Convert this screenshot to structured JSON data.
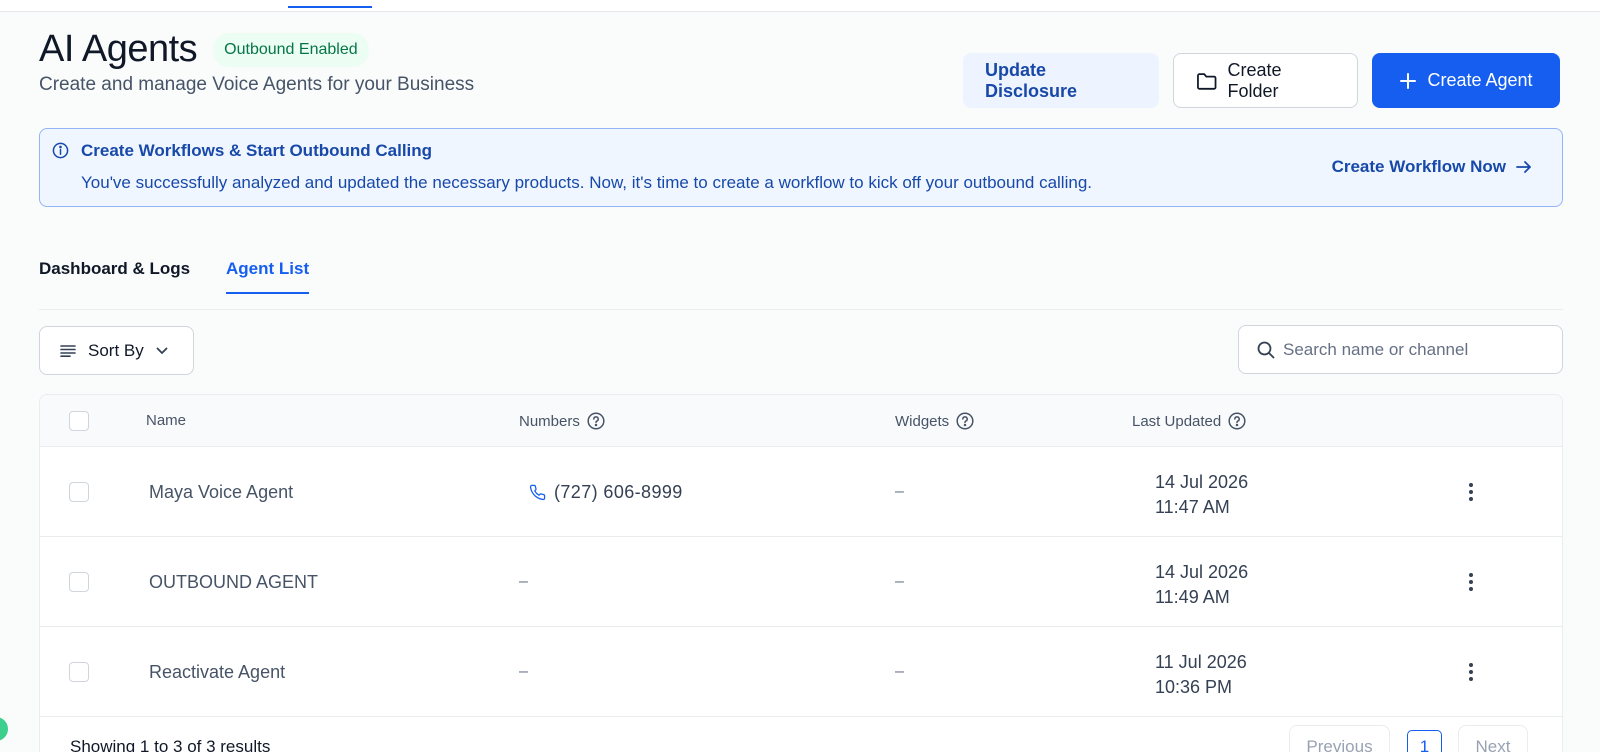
{
  "header": {
    "title": "AI Agents",
    "badge": "Outbound Enabled",
    "subtitle": "Create and manage Voice Agents for your Business",
    "buttons": {
      "disclosure": "Update Disclosure",
      "folder": "Create Folder",
      "create": "Create Agent"
    }
  },
  "banner": {
    "title": "Create Workflows & Start Outbound Calling",
    "text": "You've successfully analyzed and updated the necessary products. Now, it's time to create a workflow to kick off your outbound calling.",
    "link": "Create Workflow Now"
  },
  "tabs": [
    "Dashboard & Logs",
    "Agent List"
  ],
  "active_tab": "Agent List",
  "toolbar": {
    "sort_label": "Sort By",
    "search_placeholder": "Search name or channel"
  },
  "table": {
    "columns": [
      "Name",
      "Numbers",
      "Widgets",
      "Last Updated"
    ],
    "rows": [
      {
        "name": "Maya Voice Agent",
        "number": "(727) 606-8999",
        "widgets": "–",
        "date": "14 Jul 2026",
        "time": "11:47 AM"
      },
      {
        "name": "OUTBOUND AGENT",
        "number": "–",
        "widgets": "–",
        "date": "14 Jul 2026",
        "time": "11:49 AM"
      },
      {
        "name": "Reactivate Agent",
        "number": "–",
        "widgets": "–",
        "date": "11 Jul 2026",
        "time": "10:36 PM"
      }
    ]
  },
  "pagination": {
    "summary": "Showing 1 to 3 of 3 results",
    "previous": "Previous",
    "page": "1",
    "next": "Next"
  },
  "colors": {
    "primary": "#155eef",
    "banner_bg": "#eff6ff",
    "badge_bg": "#ecfdf3",
    "badge_text": "#067647"
  }
}
